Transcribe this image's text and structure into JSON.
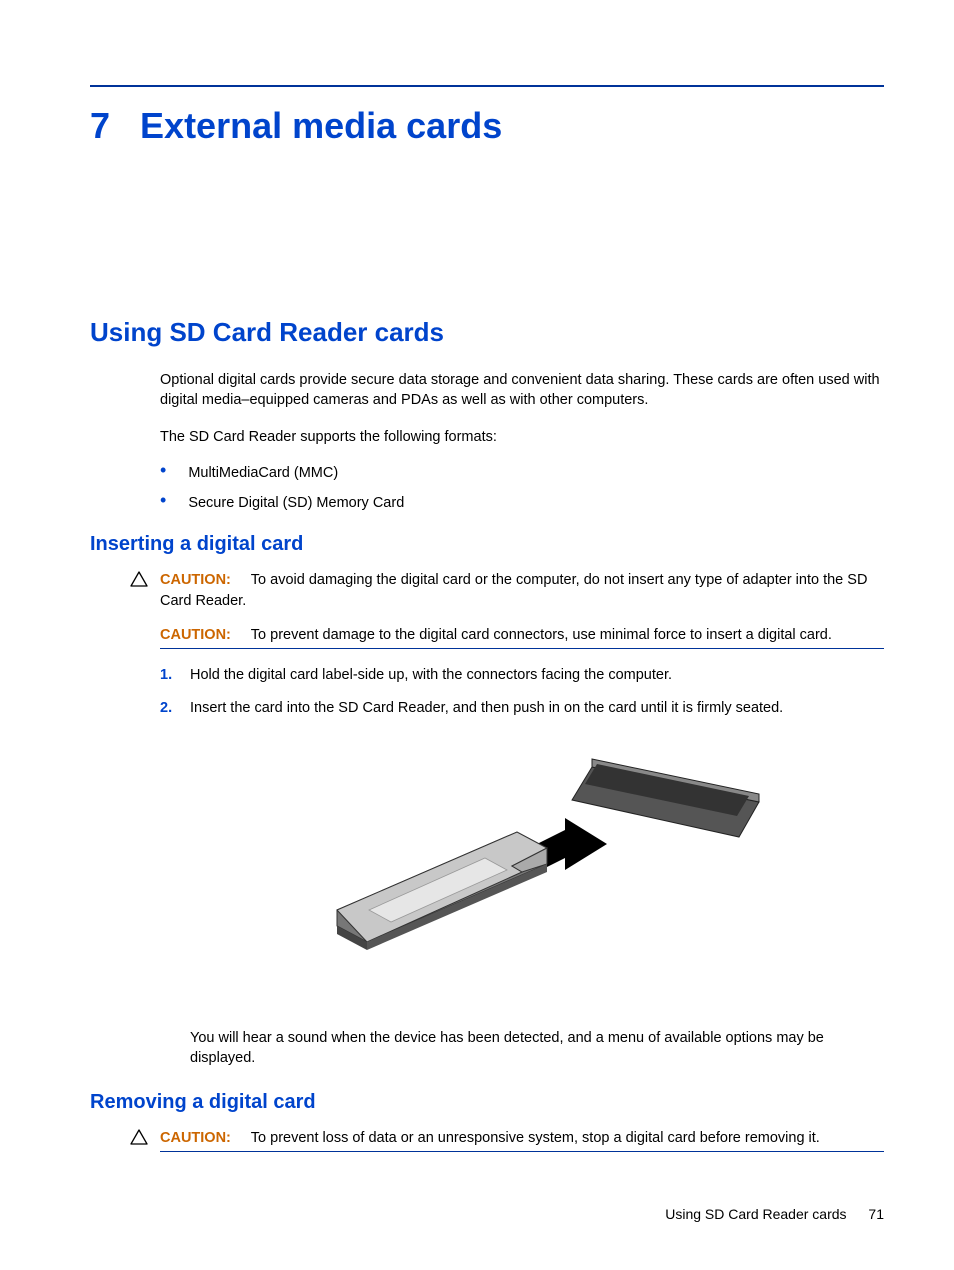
{
  "chapter": {
    "number": "7",
    "title": "External media cards"
  },
  "section1": {
    "title": "Using SD Card Reader cards",
    "para1": "Optional digital cards provide secure data storage and convenient data sharing. These cards are often used with digital media–equipped cameras and PDAs as well as with other computers.",
    "para2": "The SD Card Reader supports the following formats:",
    "bullets": [
      "MultiMediaCard (MMC)",
      "Secure Digital (SD) Memory Card"
    ]
  },
  "section2": {
    "title": "Inserting a digital card",
    "caution1_label": "CAUTION:",
    "caution1_text": "To avoid damaging the digital card or the computer, do not insert any type of adapter into the SD Card Reader.",
    "caution2_label": "CAUTION:",
    "caution2_text": "To prevent damage to the digital card connectors, use minimal force to insert a digital card.",
    "steps": [
      {
        "n": "1.",
        "text": "Hold the digital card label-side up, with the connectors facing the computer."
      },
      {
        "n": "2.",
        "text": "Insert the card into the SD Card Reader, and then push in on the card until it is firmly seated."
      }
    ],
    "post_illustration": "You will hear a sound when the device has been detected, and a menu of available options may be displayed."
  },
  "section3": {
    "title": "Removing a digital card",
    "caution1_label": "CAUTION:",
    "caution1_text": "To prevent loss of data or an unresponsive system, stop a digital card before removing it."
  },
  "footer": {
    "title": "Using SD Card Reader cards",
    "page": "71"
  }
}
